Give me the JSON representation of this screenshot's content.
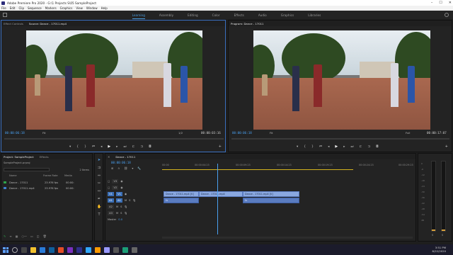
{
  "window": {
    "title": "Adobe Premiere Pro 2020 - G:\\1 Projects S\\05 SampleProject"
  },
  "menu": [
    "File",
    "Edit",
    "Clip",
    "Sequence",
    "Markers",
    "Graphics",
    "View",
    "Window",
    "Help"
  ],
  "workspaces": [
    "Learning",
    "Assembly",
    "Editing",
    "Color",
    "Effects",
    "Audio",
    "Graphics",
    "Libraries"
  ],
  "source": {
    "tabs": [
      "Effect Controls",
      "Source: Dance - 17011.mp4"
    ],
    "timecode": "00:00:06:18",
    "duration": "00:00:03:16",
    "fit": "Fit",
    "ratio": "1/2"
  },
  "program": {
    "tabs": [
      "Program: Dance - 17011"
    ],
    "timecode": "00:00:06:18",
    "duration": "00:00:17:07",
    "fit": "Fit",
    "ratio": "Full"
  },
  "project": {
    "tabs": [
      "Project: SampleProject",
      "Effects"
    ],
    "path": "SampleProject.prproj",
    "count": "2 Items",
    "headers": [
      "Name",
      "Frame Rate",
      "Media"
    ],
    "items": [
      {
        "name": "Dance - 17011",
        "rate": "23.976 fps",
        "media": "00:00:"
      },
      {
        "name": "Dance - 17011.mp4",
        "rate": "23.976 fps",
        "media": "00:00:"
      }
    ]
  },
  "timeline": {
    "tab": "Dance - 17011",
    "timecode": "00:00:06:18",
    "ruler": [
      "00:00",
      "00:00:04:23",
      "00:00:09:23",
      "00:00:14:23",
      "00:00:19:23",
      "00:00:24:23",
      "00:00:29:23"
    ],
    "video_tracks": [
      "V3",
      "V2",
      "V1"
    ],
    "audio_tracks": [
      "A1",
      "A2",
      "A3"
    ],
    "master": "Master",
    "master_val": "0.0",
    "clips_video": [
      "Dance - 17011.mp4 [V]",
      "Dance - 17011.mp4",
      "Dance - 17011.mp4 [V]"
    ],
    "clips_audio": [
      "fx",
      "fx",
      "fx"
    ]
  },
  "meter": {
    "scale": [
      "0",
      "-6",
      "-12",
      "-18",
      "-24",
      "-30",
      "-36",
      "-42",
      "-48",
      "-54",
      "dB"
    ],
    "labels": [
      "S",
      "S"
    ]
  },
  "taskbar": {
    "time": "3:51 PM",
    "date": "8/22/2020"
  }
}
